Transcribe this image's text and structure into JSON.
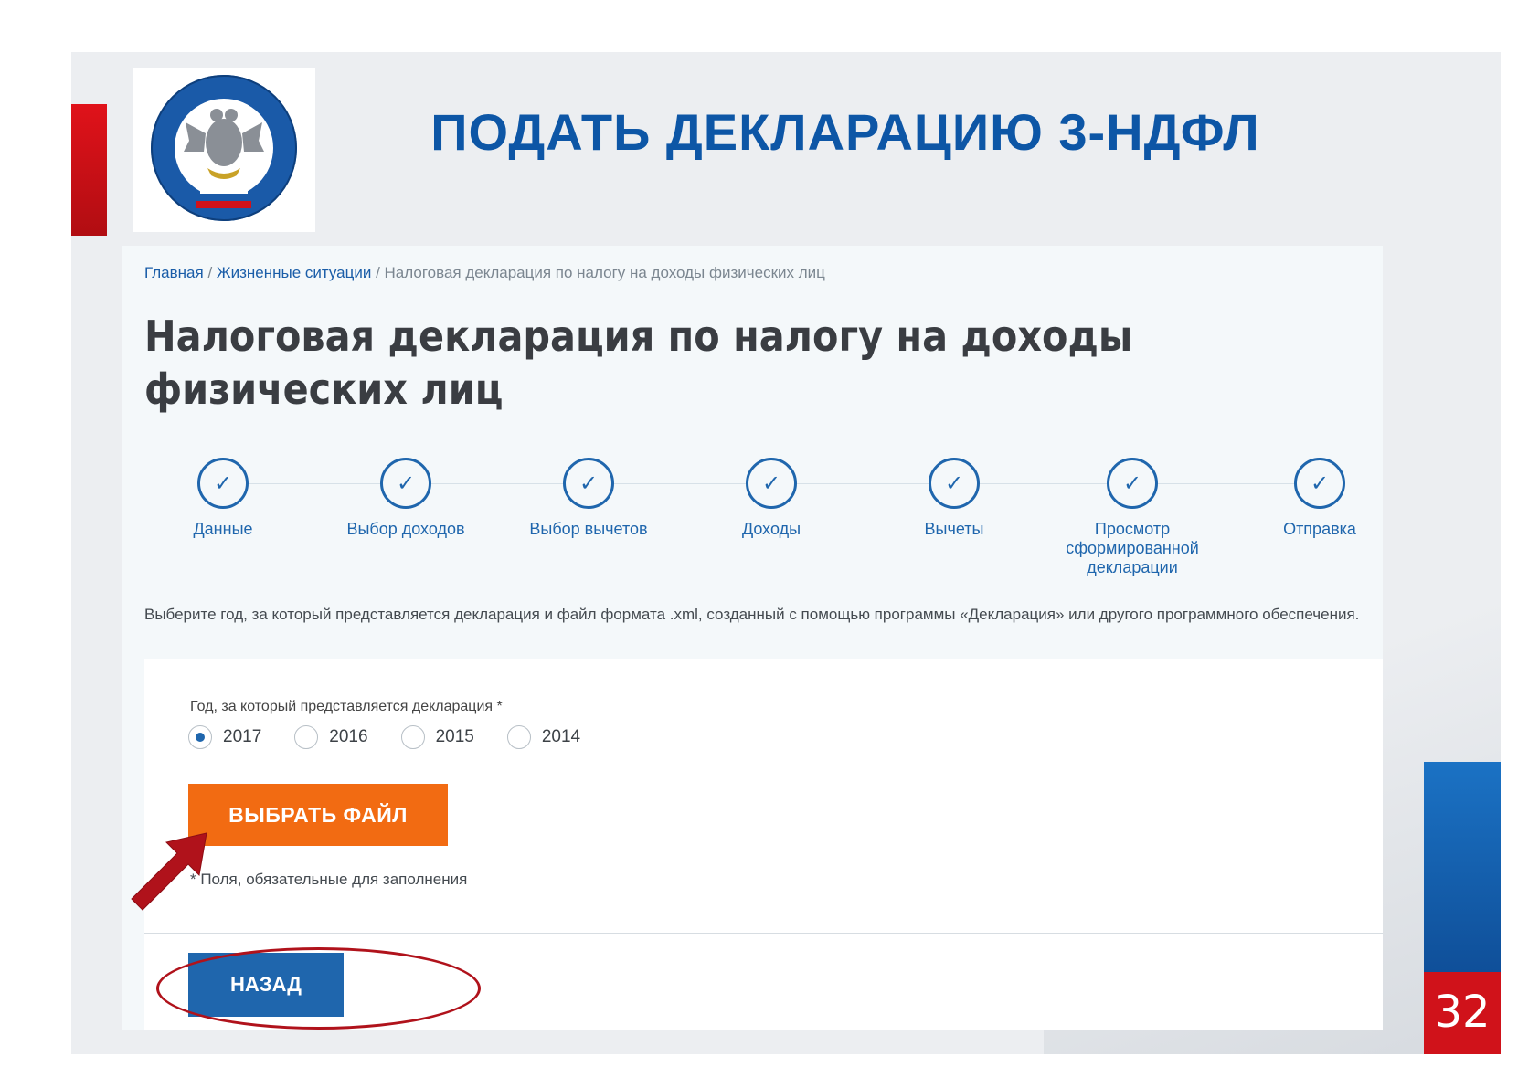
{
  "slide": {
    "title": "ПОДАТЬ ДЕКЛАРАЦИЮ 3-НДФЛ",
    "page_number": "32",
    "logo_icon": "fns-emblem-icon",
    "colors": {
      "title": "#0d56a6",
      "accent_red": "#d0121a",
      "accent_blue": "#1b72c4"
    }
  },
  "breadcrumb": {
    "home": "Главная",
    "sep": " / ",
    "life": "Жизненные ситуации",
    "current": "Налоговая декларация по налогу на доходы физических лиц"
  },
  "page_title": "Налоговая декларация по налогу на доходы физических лиц",
  "steps": [
    {
      "label": "Данные",
      "icon": "check-icon"
    },
    {
      "label": "Выбор доходов",
      "icon": "check-icon"
    },
    {
      "label": "Выбор вычетов",
      "icon": "check-icon"
    },
    {
      "label": "Доходы",
      "icon": "check-icon"
    },
    {
      "label": "Вычеты",
      "icon": "check-icon"
    },
    {
      "label": "Просмотр сформированной декларации",
      "icon": "check-icon"
    },
    {
      "label": "Отправка",
      "icon": "check-icon"
    }
  ],
  "description": "Выберите год, за который представляется декларация и файл формата .xml, созданный с помощью программы «Декларация» или другого программного обеспечения.",
  "form": {
    "year_label": "Год, за который представляется декларация *",
    "years": [
      "2017",
      "2016",
      "2015",
      "2014"
    ],
    "selected_year": "2017",
    "file_button": "ВЫБРАТЬ ФАЙЛ",
    "required_note": "* Поля, обязательные для заполнения",
    "back_button": "НАЗАД",
    "colors": {
      "file_button": "#f26b12",
      "back_button": "#1f66ad",
      "highlight": "#b0121b"
    }
  }
}
